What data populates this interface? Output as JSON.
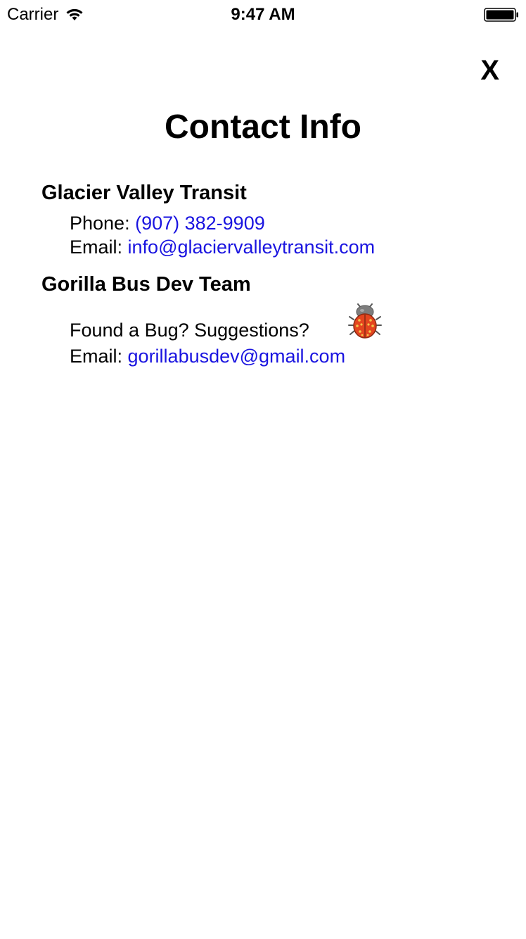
{
  "status_bar": {
    "carrier": "Carrier",
    "time": "9:47 AM",
    "wifi_icon": "wifi-icon",
    "battery_icon": "battery-icon"
  },
  "close_label": "X",
  "title": "Contact Info",
  "sections": [
    {
      "heading": "Glacier Valley Transit",
      "phone_label": "Phone:",
      "phone_value": "(907) 382-9909",
      "email_label": "Email:",
      "email_value": "info@glaciervalleytransit.com"
    },
    {
      "heading": "Gorilla Bus Dev Team",
      "prompt": "Found a Bug? Suggestions?",
      "prompt_icon": "ladybug-icon",
      "email_label": "Email:",
      "email_value": "gorillabusdev@gmail.com"
    }
  ],
  "colors": {
    "link": "#1a14e0",
    "text": "#000000",
    "background": "#ffffff"
  }
}
